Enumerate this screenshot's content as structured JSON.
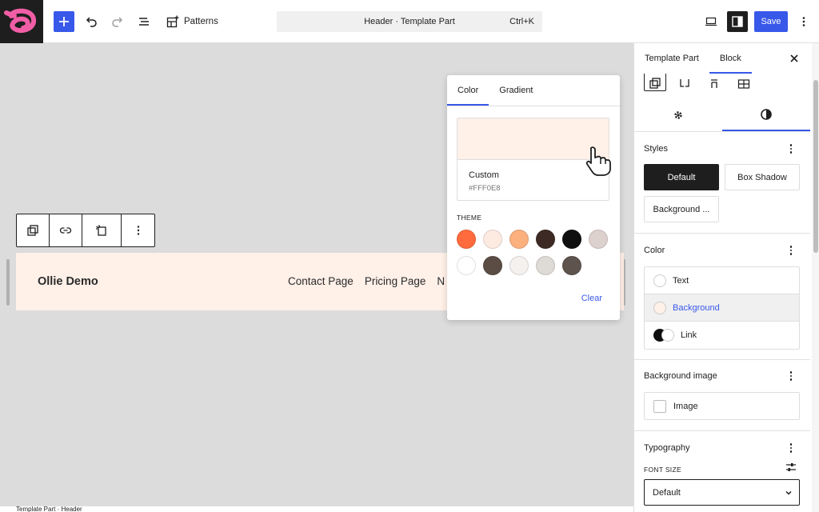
{
  "topbar": {
    "patterns_label": "Patterns",
    "command_title": "Header · Template Part",
    "command_shortcut": "Ctrl+K",
    "save_label": "Save"
  },
  "canvas": {
    "site_title": "Ollie Demo",
    "nav_items": [
      "Contact Page",
      "Pricing Page",
      "N"
    ]
  },
  "color_popover": {
    "tabs": [
      "Color",
      "Gradient"
    ],
    "active_tab": "Color",
    "selected_name": "Custom",
    "selected_hex": "#FFF0E8",
    "theme_label": "THEME",
    "palette": [
      "#FF6B3D",
      "#FDEBE2",
      "#FBB07E",
      "#3D2A24",
      "#0F0F0F",
      "#DDD1CD",
      "#FFFFFF",
      "#5B4C44",
      "#F4F1EF",
      "#DEDAD6",
      "#5E534D"
    ],
    "clear_label": "Clear"
  },
  "sidebar": {
    "tabs": [
      "Template Part",
      "Block"
    ],
    "active_tab": "Block",
    "styles_title": "Styles",
    "style_buttons": [
      "Default",
      "Box Shadow",
      "Background ..."
    ],
    "color_title": "Color",
    "color_items": [
      "Text",
      "Background",
      "Link"
    ],
    "bg_image_title": "Background image",
    "image_label": "Image",
    "typography_title": "Typography",
    "font_size_label": "FONT SIZE",
    "font_size_value": "Default"
  },
  "footer": {
    "breadcrumb": "Template Part · Header"
  },
  "colors": {
    "accent": "#3858e9",
    "header_background": "#FFF0E8",
    "dark": "#1e1e1e"
  }
}
